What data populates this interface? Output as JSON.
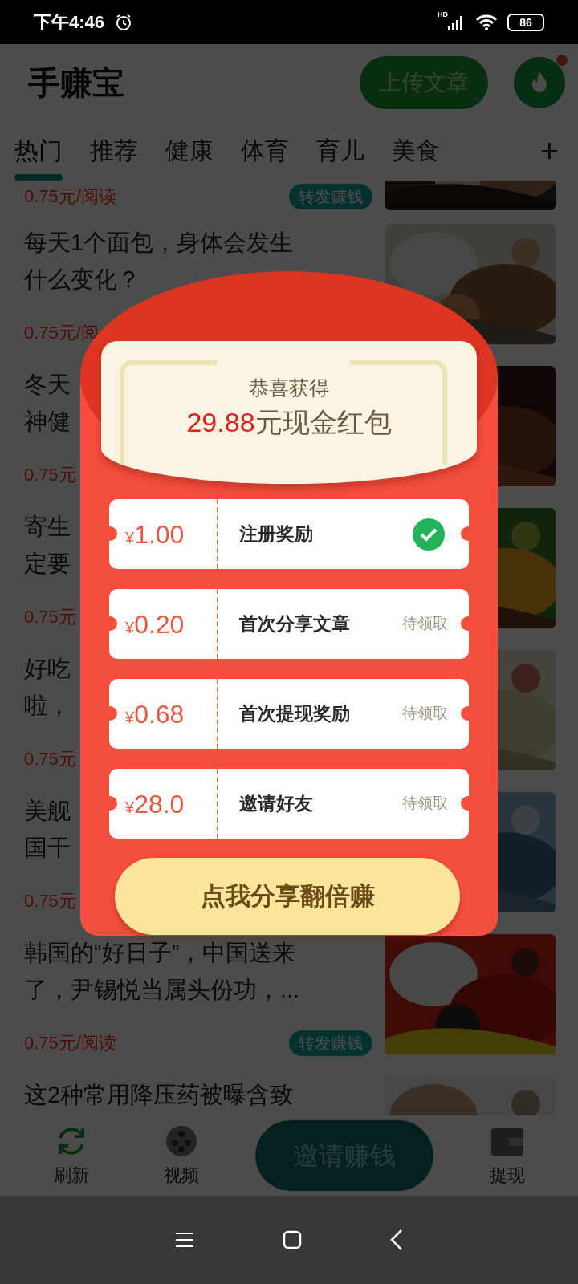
{
  "status_bar": {
    "time": "下午4:46",
    "network": "HD",
    "battery": "86"
  },
  "header": {
    "title": "手赚宝",
    "upload_button": "上传文章",
    "notification_dot": true
  },
  "tabs": [
    {
      "label": "热门",
      "selected": true
    },
    {
      "label": "推荐",
      "selected": false
    },
    {
      "label": "健康",
      "selected": false
    },
    {
      "label": "体育",
      "selected": false
    },
    {
      "label": "育儿",
      "selected": false
    },
    {
      "label": "美食",
      "selected": false
    }
  ],
  "add_tab": "+",
  "articles": [
    {
      "price": "0.75元/阅读",
      "tag": "转发赚钱"
    },
    {
      "title_lines": [
        "每天1个面包，身体会发生",
        "什么变化？"
      ],
      "price": "0.75元/阅"
    },
    {
      "title_lines": [
        "冬天",
        "神健"
      ],
      "price": "0.75元"
    },
    {
      "title_lines": [
        "寄生",
        "定要"
      ],
      "price": "0.75元"
    },
    {
      "title_lines": [
        "好吃",
        "啦，"
      ],
      "price": "0.75元"
    },
    {
      "title_lines": [
        "美舰",
        "国干"
      ],
      "price": "0.75元"
    },
    {
      "title_lines": [
        "韩国的“好日子”，中国送来",
        "了，尹锡悦当属头份功，..."
      ],
      "price": "0.75元/阅读",
      "tag": "转发赚钱"
    },
    {
      "title_lines": [
        "这2种常用降压药被曝含致"
      ]
    }
  ],
  "bottom_nav": [
    {
      "label": "刷新",
      "kind": "refresh"
    },
    {
      "label": "视频",
      "kind": "video"
    },
    {
      "label": "邀请赚钱",
      "kind": "pill"
    },
    {
      "label": "提现",
      "kind": "wallet"
    }
  ],
  "popup": {
    "heading": "恭喜获得",
    "amount": "29.88",
    "amount_suffix": "元现金红包",
    "rewards": [
      {
        "currency": "¥",
        "amount": "1.00",
        "title": "注册奖励",
        "claimed": true
      },
      {
        "currency": "¥",
        "amount": "0.20",
        "title": "首次分享文章",
        "claimed": false,
        "status": "待领取"
      },
      {
        "currency": "¥",
        "amount": "0.68",
        "title": "首次提现奖励",
        "claimed": false,
        "status": "待领取"
      },
      {
        "currency": "¥",
        "amount": "28.0",
        "title": "邀请好友",
        "claimed": false,
        "status": "待领取"
      }
    ],
    "button": "点我分享翻倍赚"
  }
}
